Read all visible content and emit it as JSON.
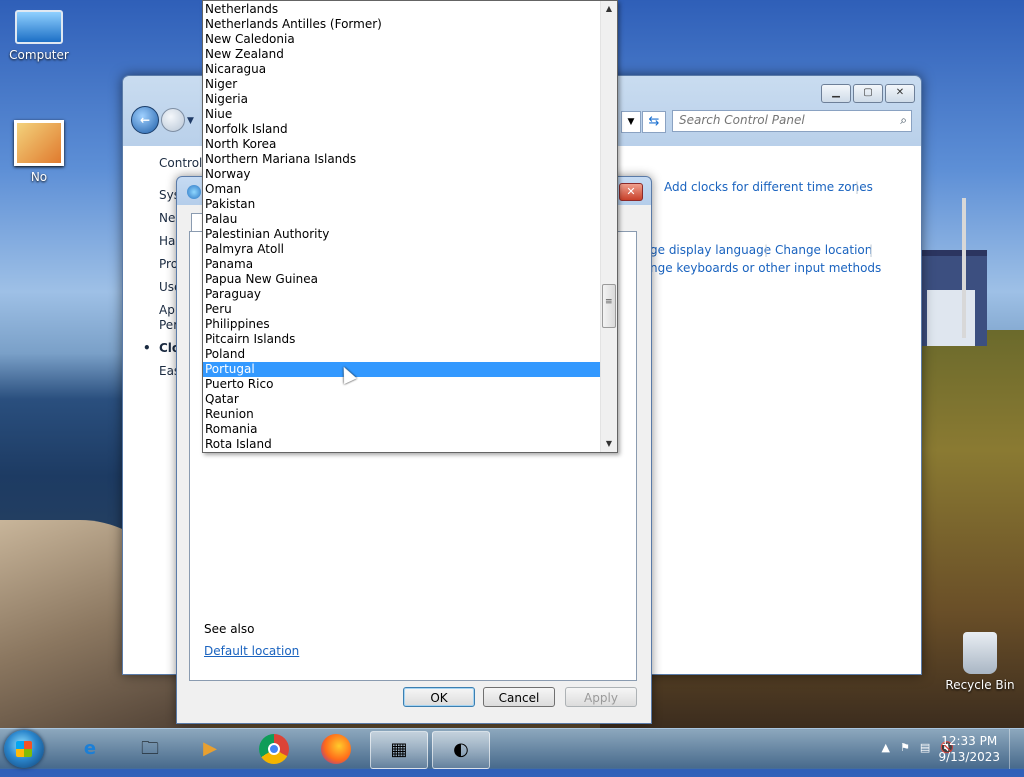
{
  "desktop": {
    "icons": [
      {
        "label": "Computer"
      },
      {
        "label": "No"
      },
      {
        "label": "Recycle Bin"
      }
    ]
  },
  "control_panel": {
    "search_placeholder": "Search Control Panel",
    "left_items": [
      "Control",
      "Sys",
      "Ne",
      "Ha",
      "Pro",
      "Use",
      "Ap",
      "Per",
      "Clo",
      "Eas"
    ],
    "links": {
      "add_clocks": "Add clocks for different time zones",
      "display_language": "ge display language",
      "change_location": "Change location",
      "keyboards": "nge keyboards or other input methods"
    }
  },
  "dialog": {
    "see_also": "See also",
    "default_location": "Default location",
    "buttons": {
      "ok": "OK",
      "cancel": "Cancel",
      "apply": "Apply"
    }
  },
  "country_list": {
    "selected": "Portugal",
    "items": [
      "Netherlands",
      "Netherlands Antilles (Former)",
      "New Caledonia",
      "New Zealand",
      "Nicaragua",
      "Niger",
      "Nigeria",
      "Niue",
      "Norfolk Island",
      "North Korea",
      "Northern Mariana Islands",
      "Norway",
      "Oman",
      "Pakistan",
      "Palau",
      "Palestinian Authority",
      "Palmyra Atoll",
      "Panama",
      "Papua New Guinea",
      "Paraguay",
      "Peru",
      "Philippines",
      "Pitcairn Islands",
      "Poland",
      "Portugal",
      "Puerto Rico",
      "Qatar",
      "Reunion",
      "Romania",
      "Rota Island"
    ]
  },
  "taskbar": {
    "buttons": [
      "start-button",
      "internet-explorer",
      "file-explorer",
      "media-player",
      "chrome",
      "firefox",
      "control-panel",
      "date-time"
    ],
    "clock_time": "12:33 PM",
    "clock_date": "9/13/2023"
  }
}
